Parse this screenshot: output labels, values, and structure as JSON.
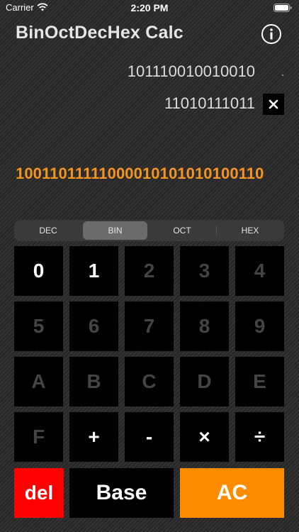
{
  "status": {
    "carrier": "Carrier",
    "time": "2:20 PM"
  },
  "app": {
    "title": "BinOctDecHex Calc"
  },
  "display": {
    "operand1": "101110010010010",
    "operand2": "11010111011",
    "operator": "×",
    "result": "10011011111000010101010100110"
  },
  "base_tabs": [
    {
      "label": "DEC",
      "selected": false
    },
    {
      "label": "BIN",
      "selected": true
    },
    {
      "label": "OCT",
      "selected": false
    },
    {
      "label": "HEX",
      "selected": false
    }
  ],
  "keys": {
    "k0": "0",
    "k1": "1",
    "k2": "2",
    "k3": "3",
    "k4": "4",
    "k5": "5",
    "k6": "6",
    "k7": "7",
    "k8": "8",
    "k9": "9",
    "kA": "A",
    "kB": "B",
    "kC": "C",
    "kD": "D",
    "kE": "E",
    "kF": "F",
    "plus": "+",
    "minus": "-",
    "multiply": "×",
    "divide": "÷",
    "del": "del",
    "base": "Base",
    "ac": "AC"
  },
  "colors": {
    "accent_result": "#f5951d",
    "del_key": "#ff0000",
    "ac_key": "#ff8c00",
    "enabled_key_text": "#ffffff",
    "disabled_key_text": "#444444"
  }
}
